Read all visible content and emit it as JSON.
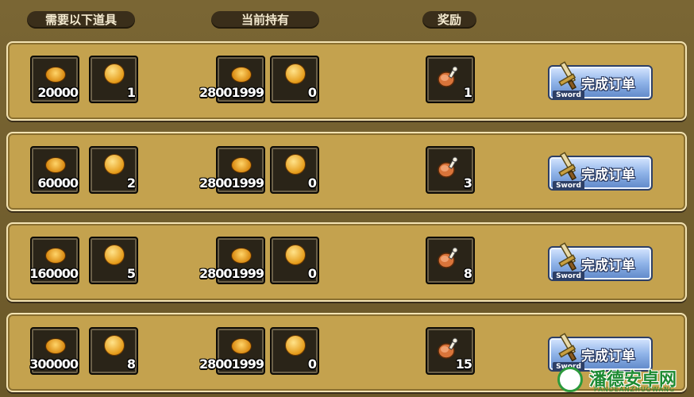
{
  "headers": {
    "required": "需要以下道具",
    "owned": "当前持有",
    "reward": "奖励"
  },
  "orders": [
    {
      "req_coins": "20000",
      "req_token": "1",
      "own_coins": "28001999",
      "own_token": "0",
      "reward_count": "1",
      "button_label": "完成订单",
      "button_tag": "Sword"
    },
    {
      "req_coins": "60000",
      "req_token": "2",
      "own_coins": "28001999",
      "own_token": "0",
      "reward_count": "3",
      "button_label": "完成订单",
      "button_tag": "Sword"
    },
    {
      "req_coins": "160000",
      "req_token": "5",
      "own_coins": "28001999",
      "own_token": "0",
      "reward_count": "8",
      "button_label": "完成订单",
      "button_tag": "Sword"
    },
    {
      "req_coins": "300000",
      "req_token": "8",
      "own_coins": "28001999",
      "own_token": "0",
      "reward_count": "15",
      "button_label": "完成订单",
      "button_tag": "Sword"
    }
  ],
  "watermark": {
    "text": "潘德安卓网",
    "sub": "PANDEANZHUOWANG"
  },
  "icons": {
    "coin": "gold-coin-icon",
    "token": "gold-token-icon",
    "reward": "meat-drumstick-icon",
    "button": "sword-icon"
  }
}
